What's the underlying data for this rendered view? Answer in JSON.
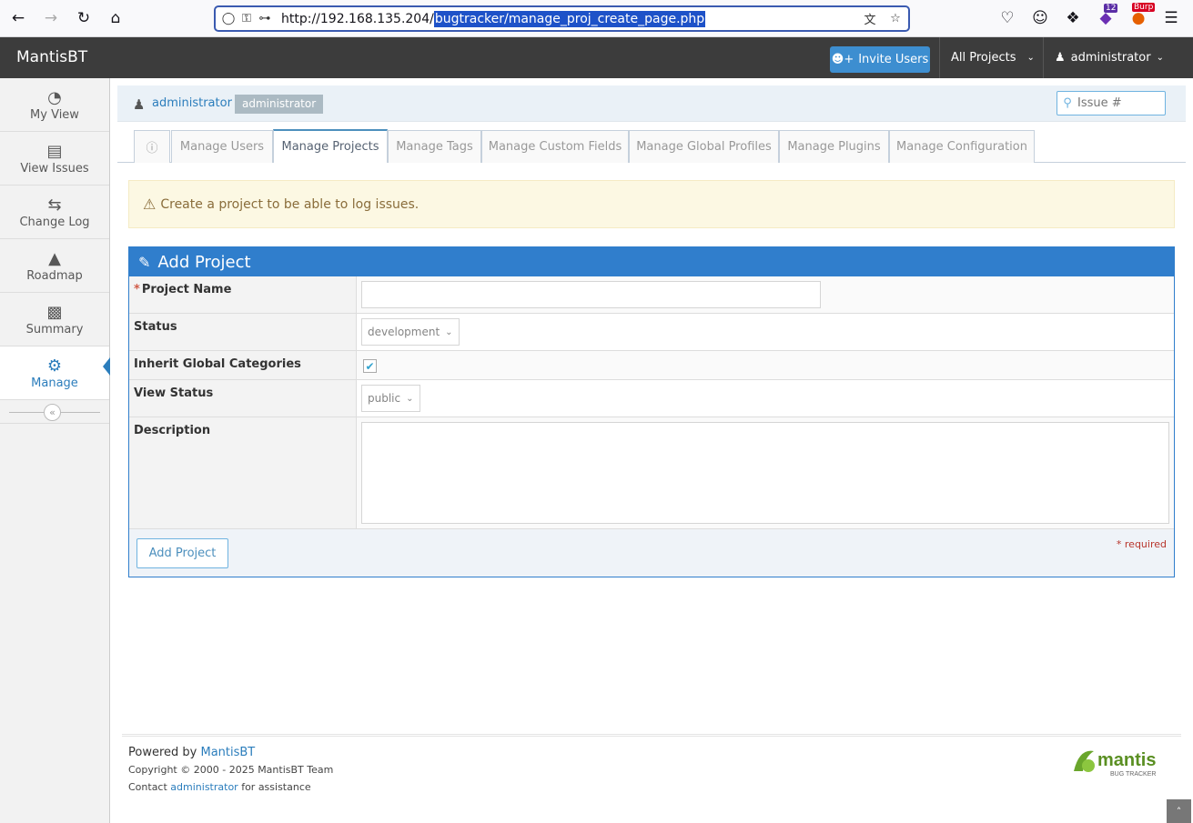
{
  "browser": {
    "url_prefix": "http://192.168.135.204/",
    "url_selected": "bugtracker/manage_proj_create_page.php",
    "extension_badge": "12",
    "burp_label": "Burp"
  },
  "navbar": {
    "brand": "MantisBT",
    "invite_label": "Invite Users",
    "project_label": "All Projects",
    "user_label": "administrator"
  },
  "sidebar": {
    "items": [
      {
        "label": "My View",
        "icon": "dashboard-icon"
      },
      {
        "label": "View Issues",
        "icon": "list-icon"
      },
      {
        "label": "Change Log",
        "icon": "retweet-icon"
      },
      {
        "label": "Roadmap",
        "icon": "road-icon"
      },
      {
        "label": "Summary",
        "icon": "bar-chart-icon"
      },
      {
        "label": "Manage",
        "icon": "gears-icon"
      }
    ]
  },
  "breadcrumb": {
    "user": "administrator",
    "role": "administrator",
    "issue_placeholder": "Issue #"
  },
  "tabs": [
    "Manage Users",
    "Manage Projects",
    "Manage Tags",
    "Manage Custom Fields",
    "Manage Global Profiles",
    "Manage Plugins",
    "Manage Configuration"
  ],
  "alert": {
    "text": "Create a project to be able to log issues."
  },
  "form": {
    "title": "Add Project",
    "project_name_label": "Project Name",
    "required_marker": "*",
    "status_label": "Status",
    "status_value": "development",
    "inherit_label": "Inherit Global Categories",
    "view_status_label": "View Status",
    "view_status_value": "public",
    "description_label": "Description",
    "submit_label": "Add Project",
    "required_note": "* required"
  },
  "footer": {
    "powered_prefix": "Powered by ",
    "powered_link": "MantisBT",
    "copyright": "Copyright © 2000 - 2025 MantisBT Team",
    "contact_prefix": "Contact ",
    "contact_link": "administrator",
    "contact_suffix": " for assistance",
    "logo_text": "mantis",
    "logo_sub": "BUG TRACKER"
  }
}
